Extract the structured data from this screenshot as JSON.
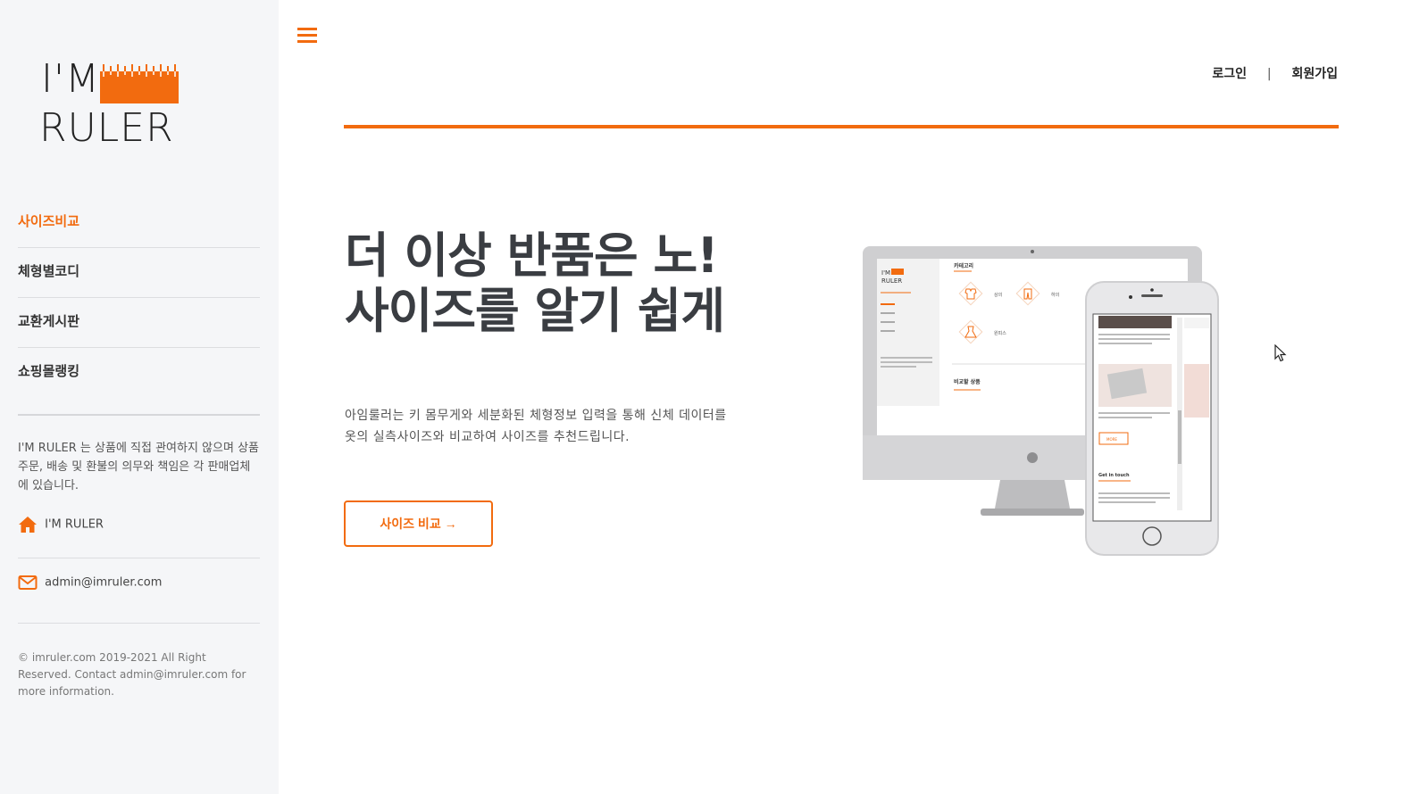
{
  "sidebar": {
    "logo": {
      "line1": "I'M",
      "line2": "RULER"
    },
    "nav": [
      {
        "label": "사이즈비교",
        "active": true
      },
      {
        "label": "체형별코디",
        "active": false
      },
      {
        "label": "교환게시판",
        "active": false
      },
      {
        "label": "쇼핑몰랭킹",
        "active": false
      }
    ],
    "disclaimer": "I'M RULER 는 상품에 직접 관여하지 않으며 상품 주문, 배송 및 환불의 의무와 책임은 각 판매업체에 있습니다.",
    "home_label": "I'M RULER",
    "email": "admin@imruler.com",
    "copyright": "© imruler.com 2019-2021 All Right Reserved. Contact admin@imruler.com for more information."
  },
  "header": {
    "login": "로그인",
    "separator": "|",
    "signup": "회원가입"
  },
  "hero": {
    "headline_line1": "더 이상 반품은 노!",
    "headline_line2": "사이즈를 알기 쉽게",
    "description": "아임룰러는 키 몸무게와 세분화된 체형정보 입력을 통해 신체 데이터를 옷의 실측사이즈와 비교하여 사이즈를 추천드립니다.",
    "cta": "사이즈 비교 →"
  },
  "mockup": {
    "desktop_logo_line1": "I'M",
    "desktop_logo_line2": "RULER",
    "desktop_category_title": "카테고리",
    "desktop_items": [
      "상의",
      "하의",
      "원피스"
    ],
    "desktop_compare_title": "비교할 상품",
    "phone_button": "MORE",
    "phone_section": "Get in touch"
  },
  "colors": {
    "accent": "#f26b0f",
    "sidebar_bg": "#f5f6f8",
    "headline": "#3a3d42"
  },
  "icons": [
    "hamburger-menu-icon",
    "home-icon",
    "mail-icon",
    "ruler-logo-icon"
  ]
}
